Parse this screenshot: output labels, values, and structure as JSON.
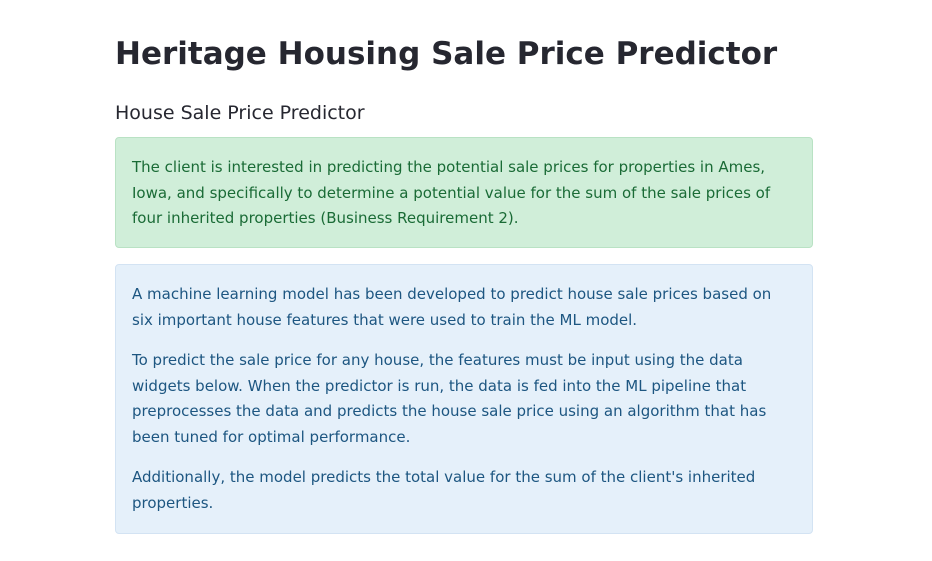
{
  "app": {
    "title": "Heritage Housing Sale Price Predictor"
  },
  "page": {
    "section_title": "House Sale Price Predictor"
  },
  "success_alert": {
    "text": "The client is interested in predicting the potential sale prices for properties in Ames, Iowa, and specifically to determine a potential value for the sum of the sale prices of four inherited properties (Business Requirement 2)."
  },
  "info_alert": {
    "paragraphs": [
      "A machine learning model has been developed to predict house sale prices based on six important house features that were used to train the ML model.",
      "To predict the sale price for any house, the features must be input using the data widgets below. When the predictor is run, the data is fed into the ML pipeline that preprocesses the data and predicts the house sale price using an algorithm that has been tuned for optimal performance.",
      "Additionally, the model predicts the total value for the sum of the client's inherited properties."
    ]
  },
  "colors": {
    "success_bg": "#d0eed9",
    "success_text": "#1a6b36",
    "info_bg": "#e5f0fa",
    "info_text": "#1d5681",
    "heading_text": "#262730"
  }
}
